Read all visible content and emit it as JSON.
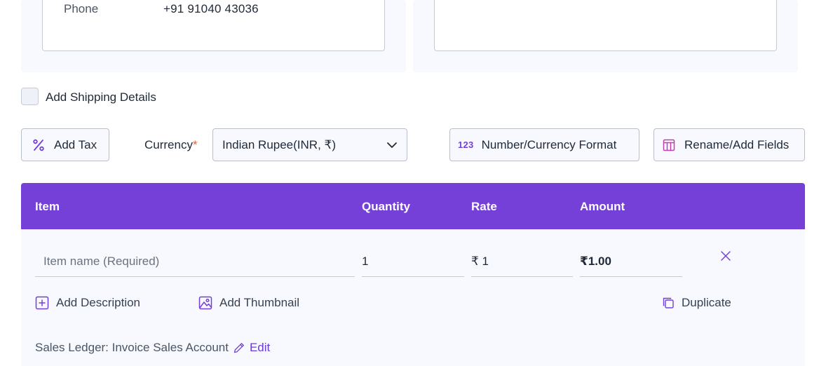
{
  "contact": {
    "phone_label": "Phone",
    "phone_value": "+91 91040 43036"
  },
  "shipping": {
    "label": "Add Shipping Details",
    "checked": false
  },
  "toolbar": {
    "add_tax_label": "Add Tax",
    "currency_label": "Currency",
    "currency_required_mark": "*",
    "currency_value": "Indian Rupee(INR, ₹)",
    "format_icon_text": "123",
    "format_label": "Number/Currency Format",
    "rename_label": "Rename/Add Fields"
  },
  "table": {
    "headers": {
      "item": "Item",
      "quantity": "Quantity",
      "rate": "Rate",
      "amount": "Amount"
    },
    "row": {
      "item_placeholder": "Item name (Required)",
      "quantity": "1",
      "rate": "₹ 1",
      "amount": "₹1.00",
      "add_description": "Add Description",
      "add_thumbnail": "Add Thumbnail",
      "duplicate": "Duplicate",
      "ledger_text": "Sales Ledger: Invoice Sales Account",
      "edit_label": "Edit"
    }
  },
  "colors": {
    "accent": "#7540d8",
    "panel_bg": "#f7f9fe",
    "border": "#c5cbd5",
    "required": "#e2643c"
  },
  "icons": {
    "tax": "percent-icon",
    "currency_dropdown": "chevron-down-icon",
    "format": "number-format-icon",
    "rename": "table-columns-icon",
    "remove": "close-icon",
    "description": "plus-square-icon",
    "thumbnail": "image-icon",
    "duplicate": "copy-icon",
    "edit": "pencil-icon"
  }
}
